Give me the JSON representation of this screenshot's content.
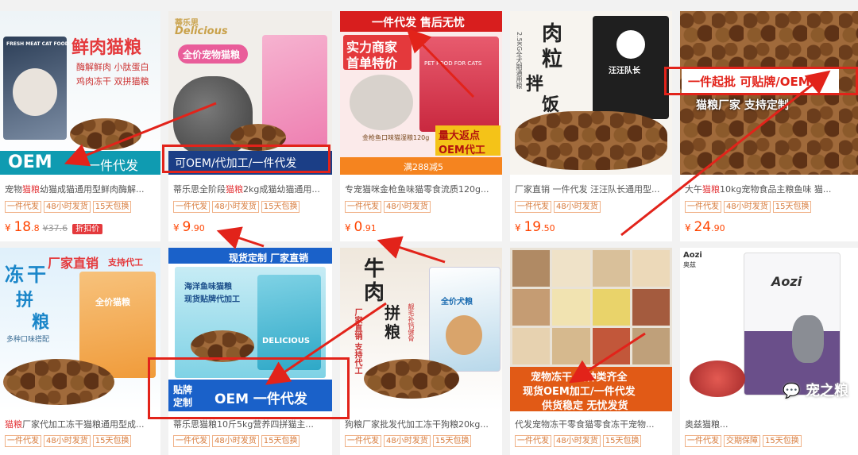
{
  "products": [
    {
      "title_pre": "宠物",
      "title_kw": "猫粮",
      "title_post": "幼猫成猫通用型鲜肉酶解...",
      "tags": [
        "一件代发",
        "48小时发货",
        "15天包换"
      ],
      "price_int": "18",
      "price_dec": ".8",
      "old_price": "¥37.6",
      "discount": "折扣价",
      "img": {
        "lines": [
          "鲜肉猫粮",
          "酶解鲜肉 小肽蛋白",
          "鸡肉冻干 双拼猫粮"
        ],
        "banner": "OEM",
        "banner2": "一件代发",
        "bag": "FRESH MEAT CAT FOOD"
      }
    },
    {
      "title_pre": "蒂乐思全阶段",
      "title_kw": "猫粮",
      "title_post": "2kg成猫幼猫通用...",
      "tags": [
        "一件代发",
        "48小时发货",
        "15天包换"
      ],
      "price_int": "9",
      "price_dec": ".90",
      "img": {
        "brand": "蒂乐思",
        "brand_en": "Delicious",
        "badge": "全价宠物猫粮",
        "banner": "可OEM/代加工/一件代发"
      }
    },
    {
      "title_pre": "专宠猫咪金枪鱼味猫零食流质120g...",
      "title_kw": "",
      "title_post": "",
      "tags": [
        "一件代发",
        "48小时发货"
      ],
      "price_int": "0",
      "price_dec": ".91",
      "img": {
        "top": "一件代发 售后无忧",
        "l1": "实力商家",
        "l2": "首单特价",
        "r1": "量大返点",
        "r2": "OEM代工",
        "bottom": "满288减5",
        "sub": "金枪鱼口味猫湿粮120g",
        "bag": "PET FOOD FOR CATS"
      }
    },
    {
      "title_pre": "厂家直销 一件代发 汪汪队长通用型...",
      "title_kw": "",
      "title_post": "",
      "tags": [
        "一件代发",
        "48小时发货"
      ],
      "price_int": "19",
      "price_dec": ".50",
      "img": {
        "big": [
          "肉",
          "粒",
          "拌",
          "饭"
        ],
        "side": "2.5KG全犬期通用粮",
        "bag": "汪汪队长"
      }
    },
    {
      "title_pre": "大午",
      "title_kw": "猫粮",
      "title_post": "10kg宠物食品主粮鱼味 猫...",
      "tags": [
        "一件代发",
        "48小时发货",
        "15天包换"
      ],
      "price_int": "24",
      "price_dec": ".90",
      "img": {
        "banner": "一件起批 可贴牌/OEM",
        "lower": "猫粮厂家 支持定制"
      }
    },
    {
      "title_pre": "",
      "title_kw": "猫粮",
      "title_post": "厂家代加工冻干猫粮通用型成...",
      "tags": [
        "一件代发",
        "48小时发货",
        "15天包换"
      ],
      "img": {
        "head": "厂家直销",
        "head2": "支持代工",
        "big": [
          "冻",
          "干",
          "拼",
          "粮"
        ],
        "side": "多种口味搭配",
        "bag": "全价猫粮"
      }
    },
    {
      "title_pre": "蒂乐思猫粮10斤5kg营养四拼猫主...",
      "title_kw": "",
      "title_post": "",
      "tags": [
        "一件代发",
        "48小时发货",
        "15天包换"
      ],
      "img": {
        "top": "现货定制 厂家直销",
        "desc": [
          "海洋鱼味猫粮",
          "现货贴牌代加工"
        ],
        "bag": "DELICIOUS",
        "tag1": "贴牌",
        "tag2": "定制",
        "banner": "OEM 一件代发"
      }
    },
    {
      "title_pre": "狗粮厂家批发代加工冻干狗粮20kg...",
      "title_kw": "",
      "title_post": "",
      "tags": [
        "一件代发",
        "48小时发货",
        "15天包换"
      ],
      "img": {
        "big": [
          "牛",
          "肉",
          "拼",
          "粮"
        ],
        "v1": "靓毛补钙健骨",
        "v2": "厂家直销 支持代工",
        "bag": "全价犬粮"
      }
    },
    {
      "title_pre": "代发宠物冻干零食猫零食冻干宠物...",
      "title_kw": "",
      "title_post": "",
      "tags": [
        "一件代发",
        "48小时发货",
        "15天包换"
      ],
      "img": {
        "line1": "宠物冻干 品种类齐全",
        "line2": "现货OEM加工/一件代发",
        "line3": "供货稳定 无忧发货"
      }
    },
    {
      "title_pre": "奥兹猫粮...",
      "title_kw": "",
      "title_post": "",
      "tags": [
        "一件代发",
        "交期保障",
        "15天包换"
      ],
      "img": {
        "logo": "Aozi",
        "logo_cn": "奥兹",
        "watermark": "宠之粮"
      }
    }
  ]
}
